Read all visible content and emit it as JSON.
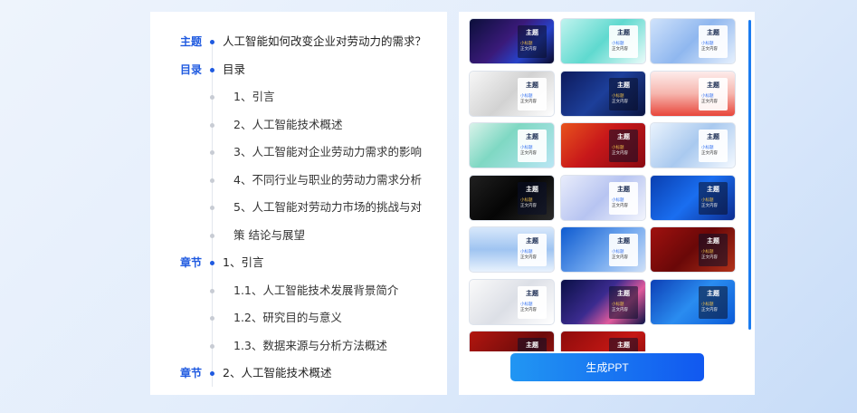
{
  "outline": {
    "rows": [
      {
        "tag": "主题",
        "text": "人工智能如何改变企业对劳动力的需求？",
        "level": 0
      },
      {
        "tag": "目录",
        "text": "目录",
        "level": 0
      },
      {
        "tag": "",
        "text": "1、引言",
        "level": 1
      },
      {
        "tag": "",
        "text": "2、人工智能技术概述",
        "level": 1
      },
      {
        "tag": "",
        "text": "3、人工智能对企业劳动力需求的影响",
        "level": 1
      },
      {
        "tag": "",
        "text": "4、不同行业与职业的劳动力需求分析",
        "level": 1
      },
      {
        "tag": "",
        "text": "5、人工智能对劳动力市场的挑战与对",
        "level": 1
      },
      {
        "tag": "",
        "text": "策 结论与展望",
        "level": 1
      },
      {
        "tag": "章节",
        "text": "1、引言",
        "level": 0
      },
      {
        "tag": "",
        "text": "1.1、人工智能技术发展背景简介",
        "level": 1
      },
      {
        "tag": "",
        "text": "1.2、研究目的与意义",
        "level": 1
      },
      {
        "tag": "",
        "text": "1.3、数据来源与分析方法概述",
        "level": 1
      },
      {
        "tag": "章节",
        "text": "2、人工智能技术概述",
        "level": 0
      }
    ]
  },
  "templates": {
    "card_title": "主题",
    "card_sub1": "小标题",
    "card_sub2": "正文内容",
    "items": [
      {
        "bg": "linear-gradient(135deg,#0b0f3a 0%,#3a1a7a 45%,#2742c9 70%,#0a0a2a 100%)",
        "card": "dark"
      },
      {
        "bg": "linear-gradient(135deg,#bff3ee 0%,#5fd9cf 50%,#e9fbf9 100%)",
        "card": "light"
      },
      {
        "bg": "linear-gradient(135deg,#cfe2fb 0%,#8fb7ef 50%,#e6f0fd 100%)",
        "card": "light"
      },
      {
        "bg": "linear-gradient(135deg,#f7f7f7 0%,#d2d2d2 50%,#ffffff 100%)",
        "card": "light"
      },
      {
        "bg": "linear-gradient(135deg,#0d1a5c 0%,#1d3f9a 50%,#0a1440 100%)",
        "card": "dark"
      },
      {
        "bg": "linear-gradient(180deg,#fdeceb 0%,#f6b5ad 50%,#e8463b 100%)",
        "card": "light"
      },
      {
        "bg": "linear-gradient(135deg,#d9f3ea 0%,#7fd8c3 40%,#b9e6f4 100%)",
        "card": "light"
      },
      {
        "bg": "linear-gradient(135deg,#e8531d 0%,#c8181a 45%,#8a0a12 100%)",
        "card": "dark"
      },
      {
        "bg": "linear-gradient(135deg,#eaf3fd 0%,#a9c9ef 50%,#f4f9ff 100%)",
        "card": "light"
      },
      {
        "bg": "linear-gradient(135deg,#202020 0%,#050505 50%,#2a2a2a 100%)",
        "card": "dark"
      },
      {
        "bg": "linear-gradient(135deg,#e8ecfb 0%,#b7c4f1 50%,#f3f5fd 100%)",
        "card": "light"
      },
      {
        "bg": "linear-gradient(135deg,#0a3fb0 0%,#1a6ef0 50%,#0c2c90 100%)",
        "card": "dark"
      },
      {
        "bg": "linear-gradient(180deg,#d8e8fb 0%,#9fc4f1 50%,#e9f2fd 100%)",
        "card": "light"
      },
      {
        "bg": "linear-gradient(135deg,#0e5bd0 0%,#6fa6ee 55%,#cfe0f8 100%)",
        "card": "light"
      },
      {
        "bg": "linear-gradient(135deg,#a0110f 0%,#6a0808 50%,#b1321a 100%)",
        "card": "dark"
      },
      {
        "bg": "linear-gradient(135deg,#fafafa 0%,#dcdfe6 50%,#ffffff 100%)",
        "card": "light"
      },
      {
        "bg": "linear-gradient(135deg,#0a1046 0%,#3b2b8f 45%,#e05a9c 70%,#0b1246 100%)",
        "card": "dark"
      },
      {
        "bg": "linear-gradient(135deg,#0d3fb5 0%,#2a8cf0 50%,#0b5bd8 100%)",
        "card": "dark"
      },
      {
        "bg": "linear-gradient(135deg,#b3160f 0%,#6d0b0b 60%,#a41a14 100%)",
        "card": "dark"
      },
      {
        "bg": "linear-gradient(135deg,#8e0c0c 0%,#c61814 60%,#770808 100%)",
        "card": "dark"
      }
    ]
  },
  "actions": {
    "generate_label": "生成PPT"
  }
}
